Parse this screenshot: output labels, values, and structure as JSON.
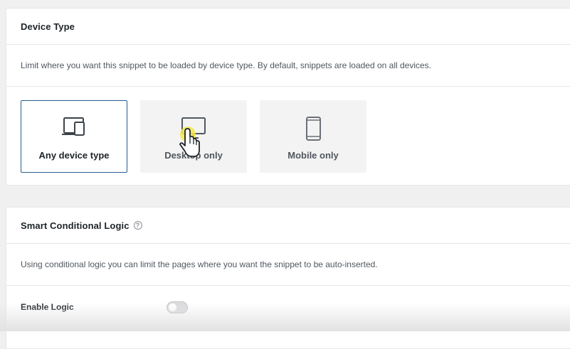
{
  "device_type": {
    "title": "Device Type",
    "description": "Limit where you want this snippet to be loaded by device type. By default, snippets are loaded on all devices.",
    "options": [
      {
        "label": "Any device type",
        "icon": "devices-icon",
        "selected": true
      },
      {
        "label": "Desktop only",
        "icon": "desktop-icon",
        "selected": false
      },
      {
        "label": "Mobile only",
        "icon": "mobile-icon",
        "selected": false
      }
    ]
  },
  "smart_logic": {
    "title": "Smart Conditional Logic",
    "help_glyph": "?",
    "description": "Using conditional logic you can limit the pages where you want the snippet to be auto-inserted.",
    "enable_label": "Enable Logic",
    "enabled": false
  },
  "colors": {
    "selected_border": "#2c5a91",
    "cursor_highlight": "#f5e84a"
  }
}
